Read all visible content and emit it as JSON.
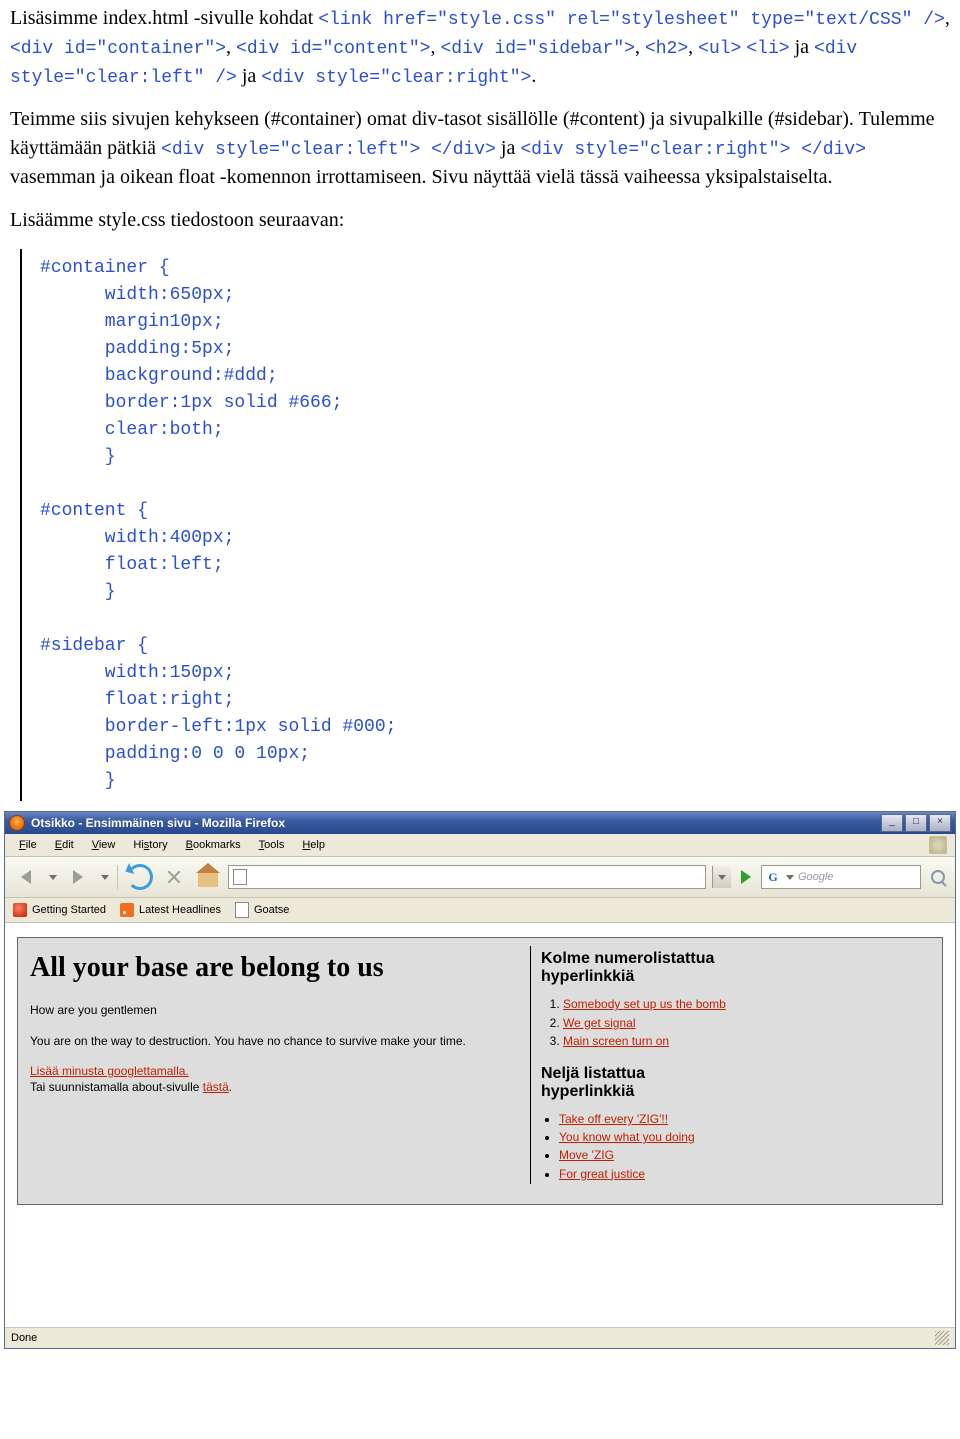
{
  "doc": {
    "p1_a": "Lisäsimme index.html -sivulle kohdat ",
    "p1_code": "<link href=\"style.css\" rel=\"stylesheet\" type=\"text/CSS\" />",
    "p1_b": ", ",
    "p1_c2": "<div id=\"container\">",
    "p1_c3": "<div id=\"content\">",
    "p1_c4": "<div id=\"sidebar\">",
    "p1_c5": "<h2>",
    "p1_c6": "<ul>",
    "p1_c7": "<li>",
    "p1_ja": " ja ",
    "p1_c8": "<div style=\"clear:left\" />",
    "p1_c9": "<div style=\"clear:right\">",
    "p1_end": ".",
    "p2_a": "Teimme siis sivujen kehykseen (#container) omat div-tasot sisällölle (#content) ja sivupalkille (#sidebar). Tulemme käyttämään pätkiä ",
    "p2_c1": "<div style=\"clear:left\"> </div>",
    "p2_c2": "<div style=\"clear:right\"> </div>",
    "p2_b": " vasemman ja oikean float -komennon irrottamiseen. Sivu näyttää vielä tässä vaiheessa yksipalstaiselta.",
    "p3": "Lisäämme style.css tiedostoon seuraavan:",
    "css_block": "#container {\n      width:650px;\n      margin10px;\n      padding:5px;\n      background:#ddd;\n      border:1px solid #666;\n      clear:both;\n      }\n\n#content {\n      width:400px;\n      float:left;\n      }\n\n#sidebar {\n      width:150px;\n      float:right;\n      border-left:1px solid #000;\n      padding:0 0 0 10px;\n      }"
  },
  "ff": {
    "title": "Otsikko - Ensimmäinen sivu - Mozilla Firefox",
    "menu": [
      "File",
      "Edit",
      "View",
      "History",
      "Bookmarks",
      "Tools",
      "Help"
    ],
    "search_placeholder": "Google",
    "bookmarks": [
      "Getting Started",
      "Latest Headlines",
      "Goatse"
    ],
    "status": "Done"
  },
  "page": {
    "h1": "All your base are belong to us",
    "p1": "How are you gentlemen",
    "p2": "You are on the way to destruction. You have no chance to survive make your time.",
    "link1": "Lisää minusta googlettamalla.",
    "p3a": "Tai suunnistamalla about-sivulle ",
    "link2": "tästä",
    "p3b": ".",
    "side_h1": "Kolme numerolistattua hyperlinkkiä",
    "ol": [
      "Somebody set up us the bomb",
      "We get signal",
      "Main screen turn on"
    ],
    "side_h2": "Neljä listattua hyperlinkkiä",
    "ul": [
      "Take off every 'ZIG'!!",
      "You know what you doing",
      "Move 'ZIG",
      "For great justice"
    ]
  }
}
